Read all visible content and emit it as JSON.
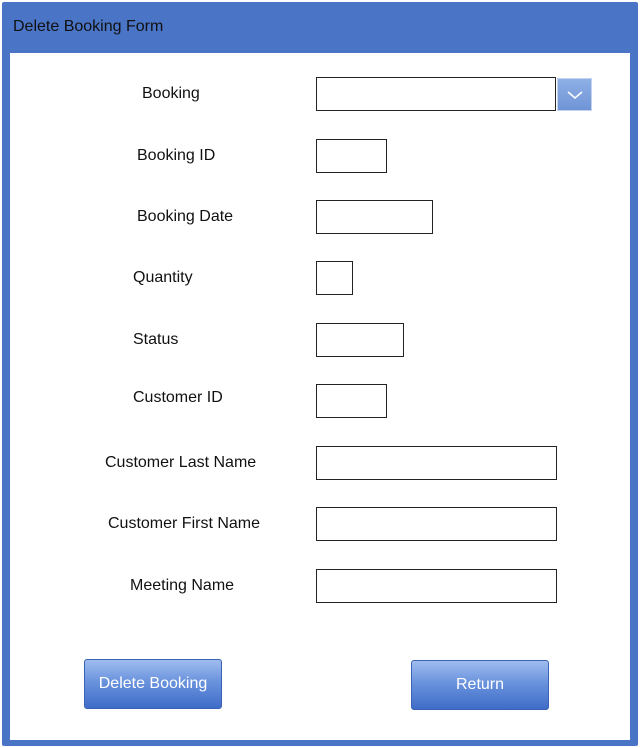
{
  "window": {
    "title": "Delete Booking Form"
  },
  "form": {
    "fields": [
      {
        "label": "Booking",
        "value": ""
      },
      {
        "label": "Booking ID",
        "value": ""
      },
      {
        "label": "Booking Date",
        "value": ""
      },
      {
        "label": "Quantity",
        "value": ""
      },
      {
        "label": "Status",
        "value": ""
      },
      {
        "label": "Customer ID",
        "value": ""
      },
      {
        "label": "Customer Last Name",
        "value": ""
      },
      {
        "label": "Customer First Name",
        "value": ""
      },
      {
        "label": "Meeting Name",
        "value": ""
      }
    ],
    "dropdown_icon": "chevron-down-icon"
  },
  "buttons": {
    "delete_label": "Delete Booking",
    "return_label": "Return"
  },
  "colors": {
    "frame": "#4a74c6",
    "button": "#5a85d6"
  }
}
